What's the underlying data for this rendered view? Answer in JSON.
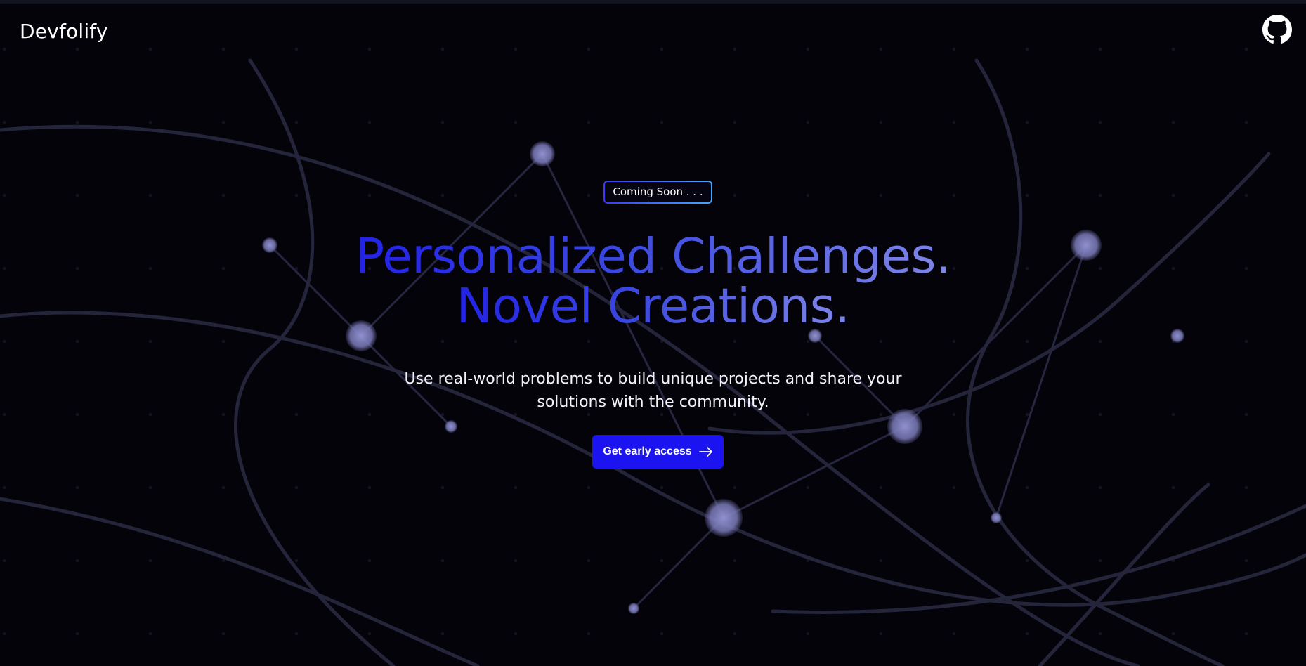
{
  "brand": {
    "name": "Devfolify"
  },
  "header": {
    "github_icon": "github-icon"
  },
  "hero": {
    "badge": "Coming Soon . . .",
    "headline_line1": "Personalized Challenges.",
    "headline_line2": "Novel Creations.",
    "subtitle": "Use real-world problems to build unique projects and share your solutions with the community.",
    "cta_label": "Get early access",
    "cta_icon": "arrow-right-icon"
  },
  "colors": {
    "background": "#040309",
    "accent": "#1b14f0",
    "gradient_start": "#2222e6",
    "gradient_end": "#7f86e8",
    "badge_border_start": "#3a3af2",
    "badge_border_end": "#43a8ff",
    "node": "#7d7db8"
  }
}
